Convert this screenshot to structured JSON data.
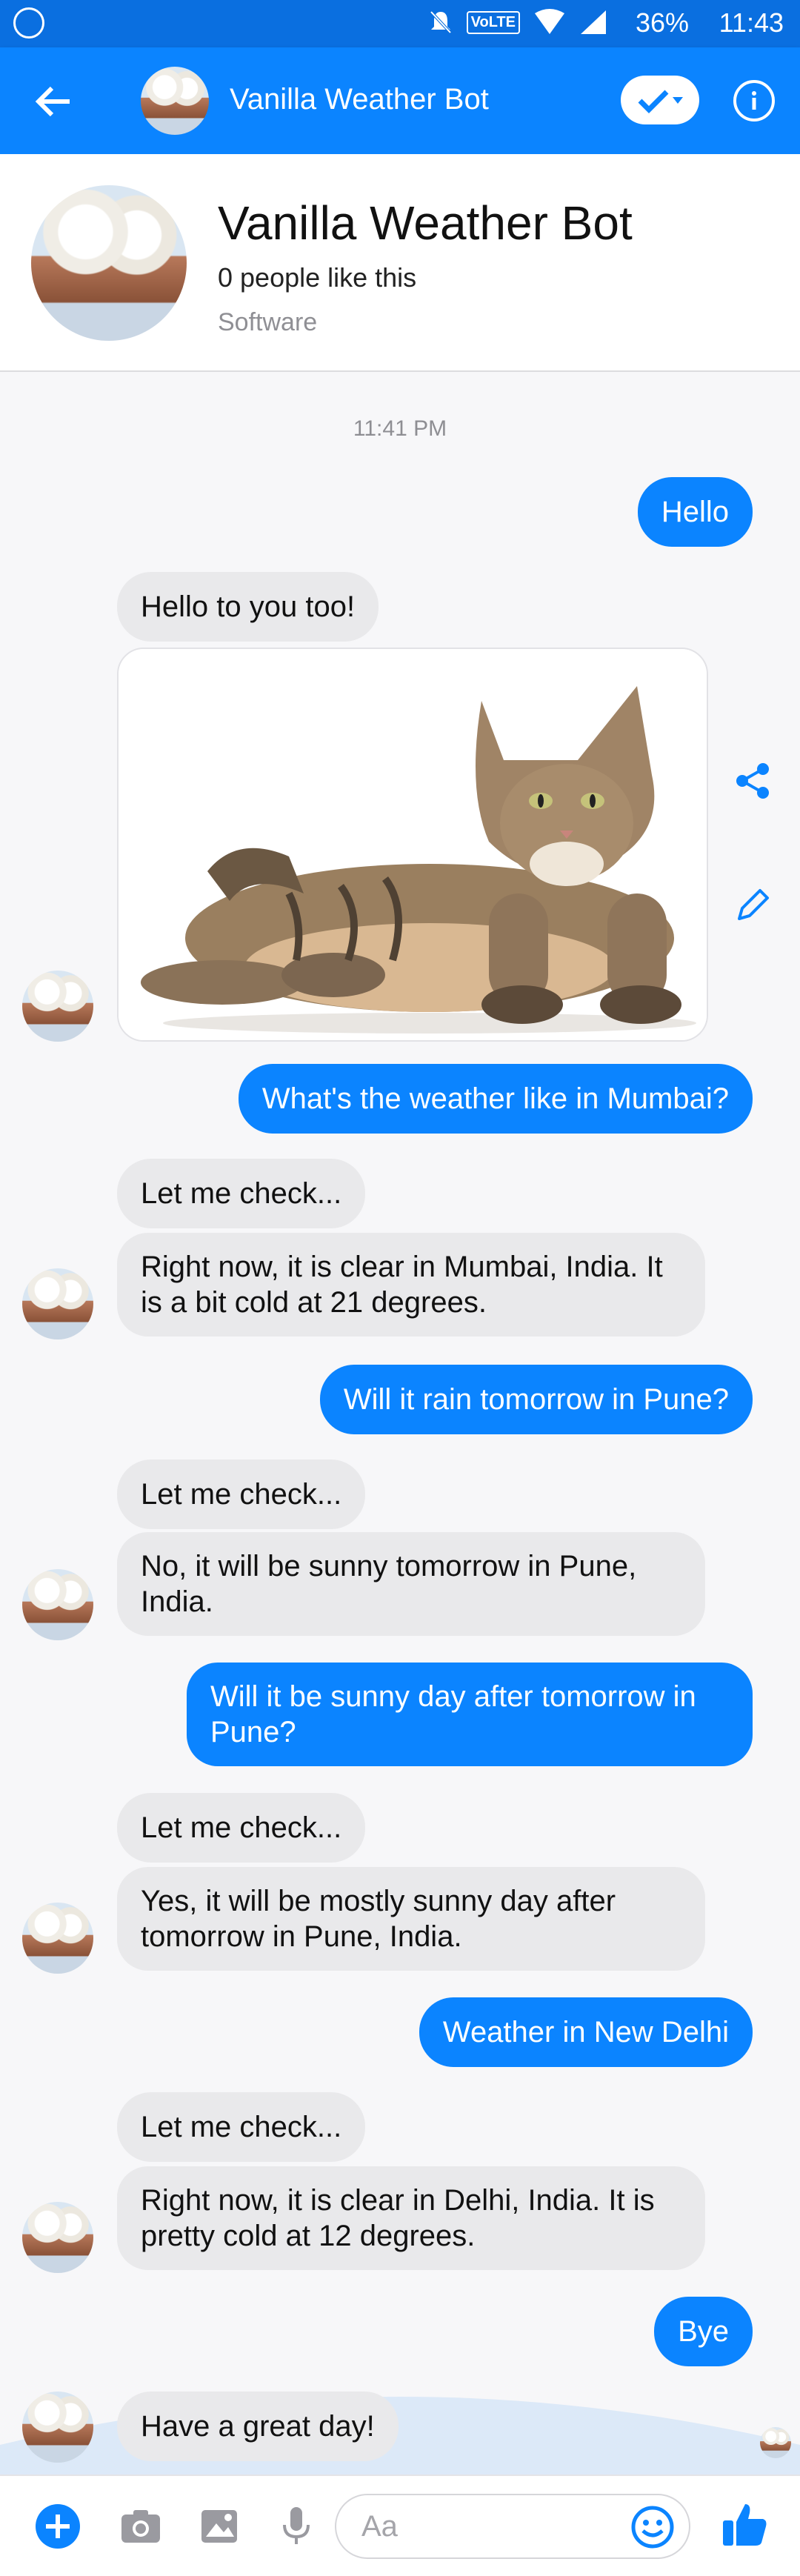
{
  "status_bar": {
    "time": "11:43",
    "battery": "36%",
    "volte": "VoLTE"
  },
  "header": {
    "title": "Vanilla Weather Bot"
  },
  "profile": {
    "name": "Vanilla Weather Bot",
    "likes": "0 people like this",
    "category": "Software"
  },
  "conversation": {
    "timestamp": "11:41 PM",
    "messages": {
      "m1": "Hello",
      "m2": "Hello to you too!",
      "m3": "What's the weather like in Mumbai?",
      "m4": "Let me check...",
      "m5": "Right now, it is clear in Mumbai, India. It is a bit cold at 21 degrees.",
      "m6": "Will it rain tomorrow in Pune?",
      "m7": "Let me check...",
      "m8": "No, it will be sunny tomorrow in Pune, India.",
      "m9": "Will it be sunny day after tomorrow in Pune?",
      "m10": "Let me check...",
      "m11": "Yes, it will be mostly sunny day after tomorrow in Pune, India.",
      "m12": "Weather in New Delhi",
      "m13": "Let me check...",
      "m14": "Right now, it is clear in Delhi, India. It is pretty cold at 12 degrees.",
      "m15": "Bye",
      "m16": "Have a great day!"
    }
  },
  "composer": {
    "placeholder": "Aa"
  },
  "colors": {
    "accent": "#0b84ff",
    "statusbar": "#0a6fe0",
    "incoming_bubble": "#e9e9eb"
  }
}
